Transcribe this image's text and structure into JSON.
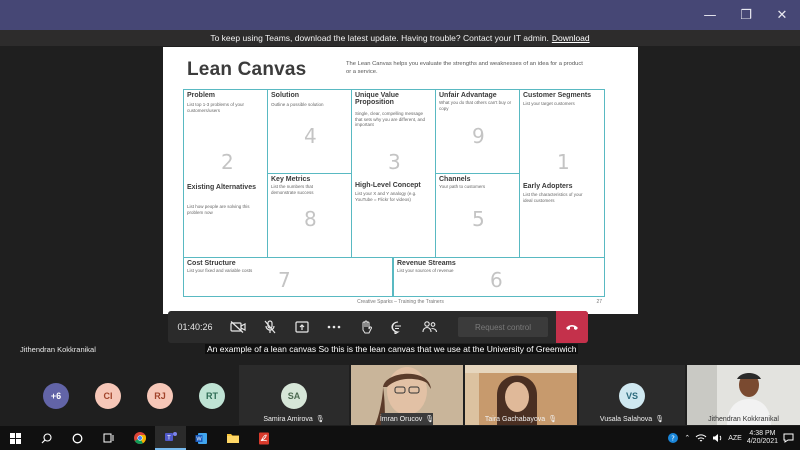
{
  "window": {
    "minimize": "—",
    "restore": "❐",
    "close": "✕"
  },
  "banner": {
    "message": "To keep using Teams, download the latest update. Having trouble? Contact your IT admin.",
    "link": "Download"
  },
  "slide": {
    "title": "Lean Canvas",
    "description": "The Lean Canvas helps you evaluate the strengths and weaknesses of an idea for a product or a service.",
    "footer": "Creative Sparks – Training the Trainers",
    "page_number": "27",
    "cells": {
      "problem": {
        "title": "Problem",
        "desc": "List top 1-3 problems of your customers/users",
        "num": "2"
      },
      "alternatives": {
        "title": "Existing Alternatives",
        "desc": "List how people are solving this problem now",
        "num": ""
      },
      "solution": {
        "title": "Solution",
        "desc": "Outline a possible solution",
        "num": "4"
      },
      "metrics": {
        "title": "Key Metrics",
        "desc": "List the numbers that demonstrate success",
        "num": "8"
      },
      "uvp": {
        "title": "Unique Value Proposition",
        "desc": "Single, clear, compelling message that sets why you are different, and important",
        "num": "3"
      },
      "concept": {
        "title": "High-Level Concept",
        "desc": "List your X and Y analogy (e.g. YouTube = Flickr for videos)",
        "num": ""
      },
      "advantage": {
        "title": "Unfair Advantage",
        "desc": "What you do that others can't buy or copy",
        "num": "9"
      },
      "channels": {
        "title": "Channels",
        "desc": "Your path to customers",
        "num": "5"
      },
      "segments": {
        "title": "Customer Segments",
        "desc": "List your target customers",
        "num": "1"
      },
      "adopters": {
        "title": "Early Adopters",
        "desc": "List the characteristics of your ideal customers",
        "num": ""
      },
      "costs": {
        "title": "Cost Structure",
        "desc": "List your fixed and variable costs",
        "num": "7"
      },
      "revenue": {
        "title": "Revenue Streams",
        "desc": "List your sources of revenue",
        "num": "6"
      }
    }
  },
  "controls": {
    "timer": "01:40:26",
    "request_control": "Request control"
  },
  "presenter_name": "Jithendran Kokkranikal",
  "caption": "An example of a lean canvas So this is the lean canvas that we use at the University of Greenwich",
  "participants": {
    "overflow": "+6",
    "avatars": [
      {
        "initials": "CI",
        "color": "#f6c7b8",
        "text": "#a0432a"
      },
      {
        "initials": "RJ",
        "color": "#f6c7b8",
        "text": "#a0432a"
      },
      {
        "initials": "RT",
        "color": "#bfe3d4",
        "text": "#2d6b55"
      }
    ],
    "tiles": [
      {
        "name": "Samira Amirova",
        "initials": "SA"
      },
      {
        "name": "İmran Orucov"
      },
      {
        "name": "Taira Gachabayova"
      },
      {
        "name": "Vusala Salahova",
        "initials": "VS"
      },
      {
        "name": "Jithendran Kokkranikal"
      }
    ]
  },
  "taskbar": {
    "lang": "AZE",
    "time": "4:38 PM",
    "date": "4/20/2021"
  }
}
